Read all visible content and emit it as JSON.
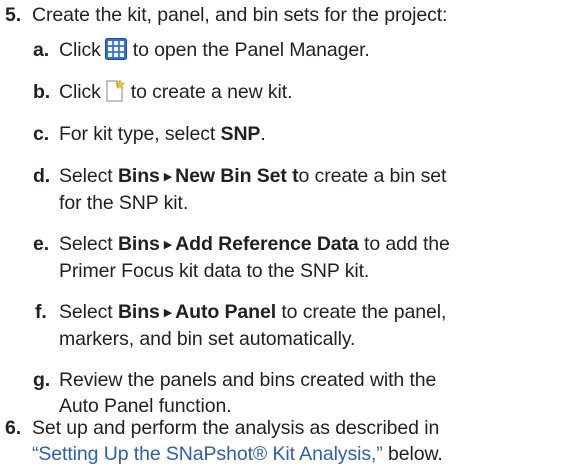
{
  "step5": {
    "number": "5.",
    "text": "Create the kit, panel, and bin sets for the project:",
    "substeps": {
      "a": {
        "letter": "a.",
        "before": "Click",
        "icon": "panel-manager-grid-icon",
        "after": "to open the Panel Manager."
      },
      "b": {
        "letter": "b.",
        "before": "Click",
        "icon": "new-kit-icon",
        "after": "to create a new kit."
      },
      "c": {
        "letter": "c.",
        "before": "For kit type, select",
        "bold": "SNP",
        "after": "."
      },
      "d": {
        "letter": "d.",
        "before": "Select",
        "menu1": "Bins",
        "menu2": "New Bin Set",
        "after_bold_t": "t",
        "after": "o create a bin set",
        "line2": "for the SNP kit."
      },
      "e": {
        "letter": "e.",
        "before": "Select",
        "menu1": "Bins",
        "menu2": "Add Reference Data",
        "after": "to add the",
        "line2": "Primer Focus kit data to the SNP kit."
      },
      "f": {
        "letter": "f.",
        "before": "Select",
        "menu1": "Bins",
        "menu2": "Auto Panel",
        "after": "to create the panel,",
        "line2": "markers, and bin set automatically."
      },
      "g": {
        "letter": "g.",
        "line1": "Review the panels and bins created with the",
        "line2": "Auto Panel function."
      }
    }
  },
  "step6": {
    "number": "6.",
    "line1": "Set up and perform the analysis as described in",
    "link": "“Setting Up the SNaPshot® Kit Analysis,”",
    "after": "below."
  },
  "colors": {
    "text": "#231f20",
    "link": "#2b5fb6",
    "icon_blue": "#2f6fd6",
    "icon_yellow": "#f2c21b"
  }
}
